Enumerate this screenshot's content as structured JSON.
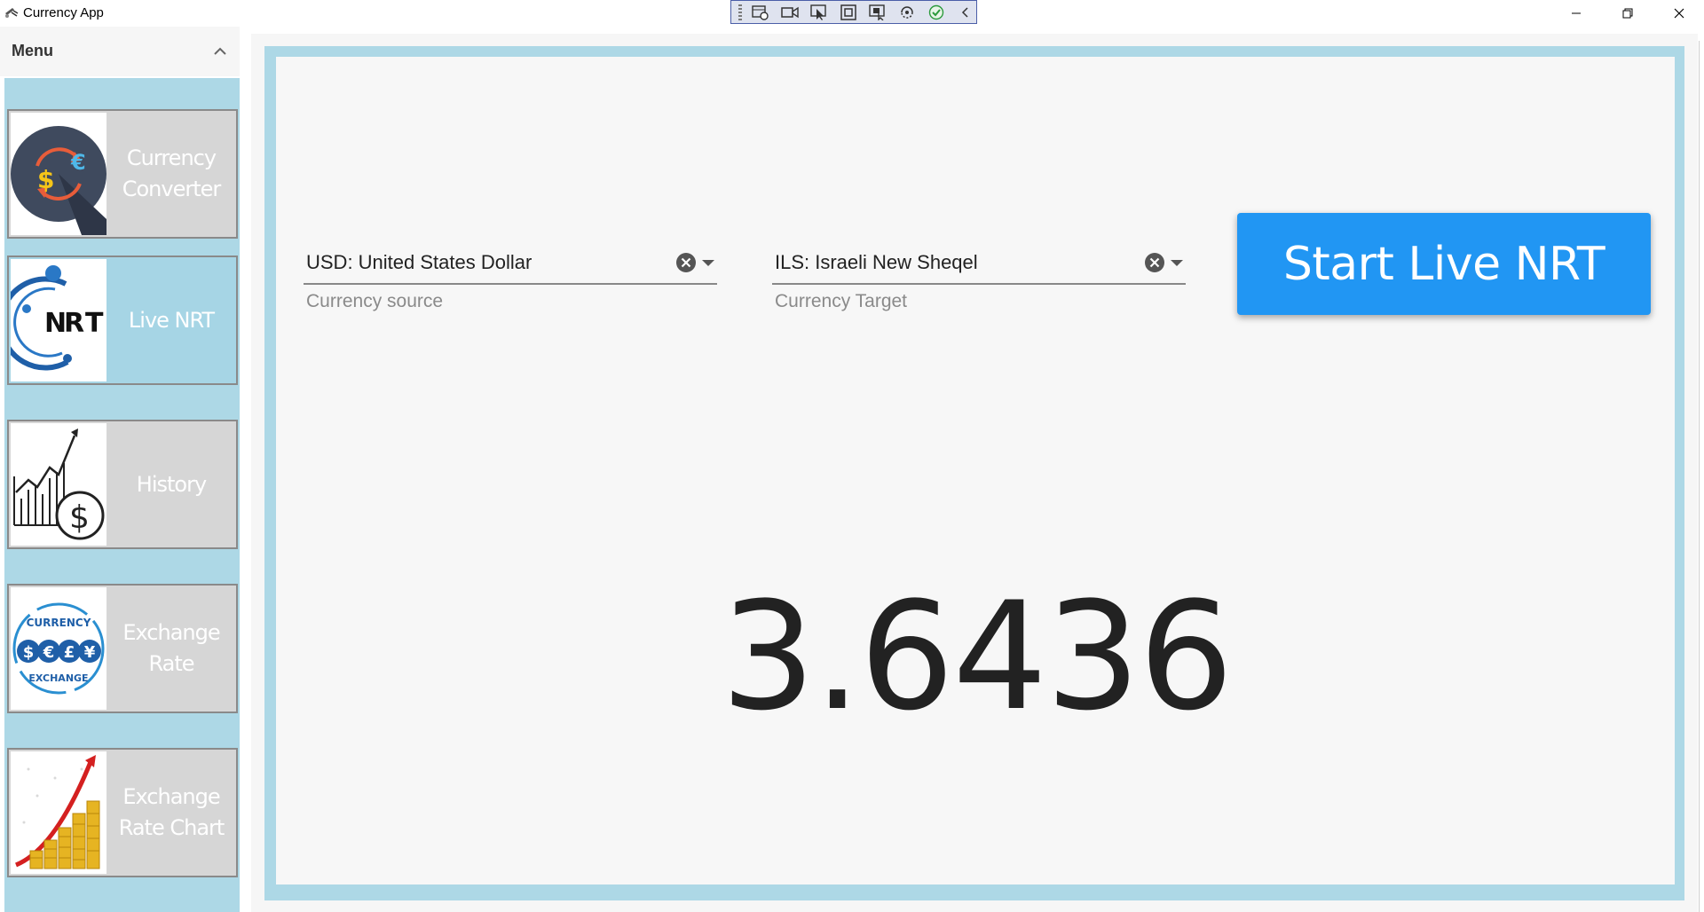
{
  "window": {
    "title": "Currency App",
    "controls": [
      "minimize",
      "restore",
      "close"
    ]
  },
  "debug_toolbar": {
    "tools": [
      "live-visual-tree-icon",
      "record-icon",
      "select-element-icon",
      "display-layout-adorners-icon",
      "track-focus-icon",
      "hot-reload-icon",
      "check-icon",
      "collapse-icon"
    ]
  },
  "sidebar": {
    "menu_title": "Menu",
    "items": [
      {
        "label": "Currency Converter",
        "icon": "currency-converter-icon",
        "active": false
      },
      {
        "label": "Live NRT",
        "icon": "nrt-logo-icon",
        "active": true
      },
      {
        "label": "History",
        "icon": "history-chart-dollar-icon",
        "active": false
      },
      {
        "label": "Exchange Rate",
        "icon": "currency-exchange-icon",
        "active": false
      },
      {
        "label": "Exchange Rate Chart",
        "icon": "rate-chart-coins-icon",
        "active": false
      }
    ]
  },
  "main": {
    "source": {
      "value": "USD: United States Dollar",
      "label": "Currency source"
    },
    "target": {
      "value": "ILS: Israeli New Sheqel",
      "label": "Currency Target"
    },
    "start_button": "Start Live NRT",
    "rate": "3.6436"
  },
  "colors": {
    "accent": "#2196f3",
    "frame": "#add8e6",
    "nav_label": "#ffffff",
    "nav_bg": "#d6d6d6",
    "nav_active_bg": "#a6d5e5"
  }
}
